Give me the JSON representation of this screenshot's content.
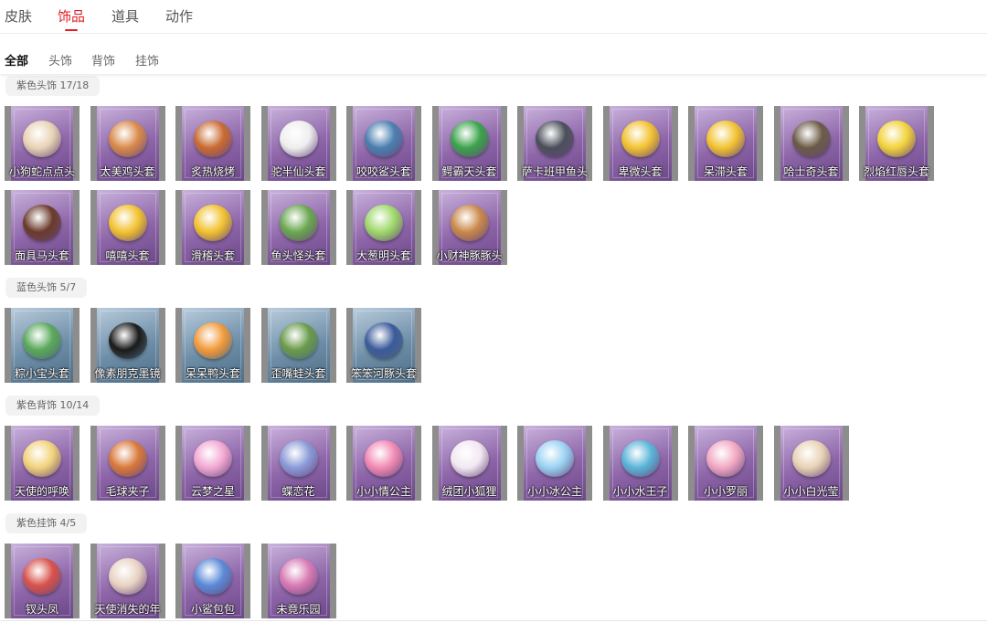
{
  "tabs": [
    "皮肤",
    "饰品",
    "道具",
    "动作"
  ],
  "active_tab": "饰品",
  "subtabs": [
    "全部",
    "头饰",
    "背饰",
    "挂饰"
  ],
  "active_subtab": "全部",
  "sections": [
    {
      "label": "紫色头饰 17/18",
      "color": "purple",
      "items": [
        {
          "name": "小狗蛇点点头",
          "tint": "#e8d3b4"
        },
        {
          "name": "太美鸡头套",
          "tint": "#d98a4a"
        },
        {
          "name": "炙热烧烤",
          "tint": "#c96b32"
        },
        {
          "name": "驼半仙头套",
          "tint": "#eeeeee"
        },
        {
          "name": "咬咬鲨头套",
          "tint": "#4a7fb0"
        },
        {
          "name": "鳄霸天头套",
          "tint": "#3aa34a"
        },
        {
          "name": "萨卡班甲鱼头",
          "tint": "#4a4f5a"
        },
        {
          "name": "卑微头套",
          "tint": "#f2c230"
        },
        {
          "name": "呆滞头套",
          "tint": "#f2c230"
        },
        {
          "name": "哈士奇头套",
          "tint": "#6b5a45"
        },
        {
          "name": "烈焰红唇头套",
          "tint": "#f2d23a"
        },
        {
          "name": "面具马头套",
          "tint": "#6a3a2a"
        },
        {
          "name": "嘻嘻头套",
          "tint": "#f2c230"
        },
        {
          "name": "滑稽头套",
          "tint": "#f2c230"
        },
        {
          "name": "鱼头怪头套",
          "tint": "#6aa84f"
        },
        {
          "name": "大葱明头套",
          "tint": "#9fd86a"
        },
        {
          "name": "小财神豚豚头",
          "tint": "#c9884a"
        }
      ]
    },
    {
      "label": "蓝色头饰 5/7",
      "color": "blue",
      "items": [
        {
          "name": "粽小宝头套",
          "tint": "#5aa85a"
        },
        {
          "name": "像素朋克墨镜",
          "tint": "#1a1a1a"
        },
        {
          "name": "呆呆鸭头套",
          "tint": "#f29a3a"
        },
        {
          "name": "歪嘴蛙头套",
          "tint": "#6a9a4a"
        },
        {
          "name": "笨笨河豚头套",
          "tint": "#3a5a9a"
        }
      ]
    },
    {
      "label": "紫色背饰 10/14",
      "color": "purple",
      "items": [
        {
          "name": "天使的呼唤",
          "tint": "#f2d27a"
        },
        {
          "name": "毛球夹子",
          "tint": "#d9783a"
        },
        {
          "name": "云梦之星",
          "tint": "#f2a8d2"
        },
        {
          "name": "蝶恋花",
          "tint": "#8a9ad8"
        },
        {
          "name": "小小情公主",
          "tint": "#f28ab4"
        },
        {
          "name": "绒团小狐狸",
          "tint": "#f2e8f2"
        },
        {
          "name": "小小冰公主",
          "tint": "#9ad2f2"
        },
        {
          "name": "小小水王子",
          "tint": "#5ab4d8"
        },
        {
          "name": "小小罗丽",
          "tint": "#f2a8c2"
        },
        {
          "name": "小小白光莹",
          "tint": "#e8d2b4"
        }
      ]
    },
    {
      "label": "紫色挂饰 4/5",
      "color": "purple",
      "items": [
        {
          "name": "钗头凤",
          "tint": "#d8524a"
        },
        {
          "name": "天使消失的年",
          "tint": "#e8d2c2"
        },
        {
          "name": "小鲨包包",
          "tint": "#5a8ad8"
        },
        {
          "name": "未竟乐园",
          "tint": "#d87ab4"
        }
      ]
    }
  ]
}
